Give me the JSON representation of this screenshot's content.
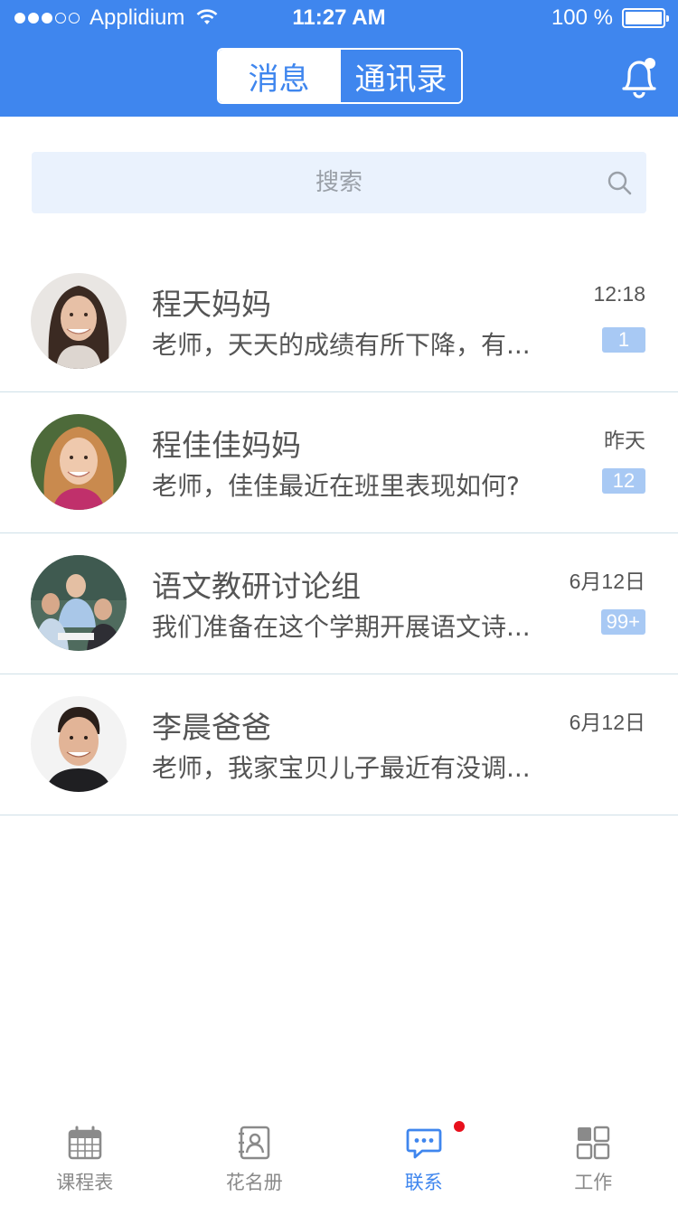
{
  "status_bar": {
    "carrier": "Applidium",
    "time": "11:27 AM",
    "battery": "100 %"
  },
  "header": {
    "segments": [
      {
        "label": "消息",
        "active": true
      },
      {
        "label": "通讯录",
        "active": false
      }
    ],
    "bell_icon": "bell-icon"
  },
  "search": {
    "placeholder": "搜索",
    "icon": "search-icon"
  },
  "conversations": [
    {
      "name": "程天妈妈",
      "preview": "老师，天天的成绩有所下降，有...",
      "time": "12:18",
      "badge": "1"
    },
    {
      "name": "程佳佳妈妈",
      "preview": "老师，佳佳最近在班里表现如何?",
      "time": "昨天",
      "badge": "12"
    },
    {
      "name": "语文教研讨论组",
      "preview": "我们准备在这个学期开展语文诗...",
      "time": "6月12日",
      "badge": "99+"
    },
    {
      "name": "李晨爸爸",
      "preview": "老师，我家宝贝儿子最近有没调...",
      "time": "6月12日",
      "badge": ""
    }
  ],
  "tabbar": {
    "items": [
      {
        "label": "课程表",
        "icon": "calendar-icon",
        "active": false
      },
      {
        "label": "花名册",
        "icon": "contact-book-icon",
        "active": false
      },
      {
        "label": "联系",
        "icon": "chat-icon",
        "active": true,
        "has_dot": true
      },
      {
        "label": "工作",
        "icon": "grid-icon",
        "active": false
      }
    ]
  },
  "colors": {
    "primary": "#3f86ee",
    "badge": "#a8c9f4",
    "search_bg": "#eaf2fd",
    "notification_dot": "#e8101c"
  }
}
